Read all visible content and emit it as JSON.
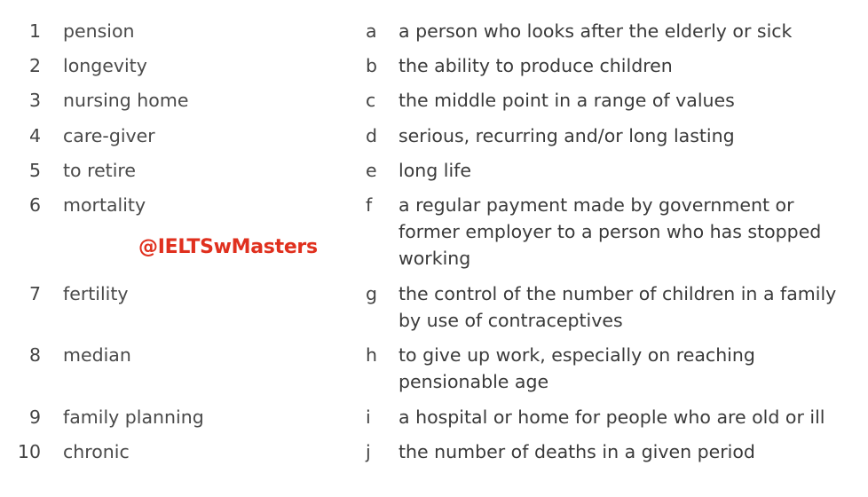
{
  "watermark": "@IELTSwMasters",
  "terms": [
    {
      "num": "1",
      "term": "pension"
    },
    {
      "num": "2",
      "term": "longevity"
    },
    {
      "num": "3",
      "term": "nursing home"
    },
    {
      "num": "4",
      "term": "care-giver"
    },
    {
      "num": "5",
      "term": "to retire"
    },
    {
      "num": "6",
      "term": "mortality"
    },
    {
      "num": "7",
      "term": "fertility"
    },
    {
      "num": "8",
      "term": "median"
    },
    {
      "num": "9",
      "term": "family planning"
    },
    {
      "num": "10",
      "term": "chronic"
    }
  ],
  "definitions": [
    {
      "letter": "a",
      "text": "a person who looks after the elderly or sick"
    },
    {
      "letter": "b",
      "text": "the ability to produce children"
    },
    {
      "letter": "c",
      "text": "the middle point in a range of values"
    },
    {
      "letter": "d",
      "text": "serious, recurring and/or long lasting"
    },
    {
      "letter": "e",
      "text": "long life"
    },
    {
      "letter": "f",
      "text": "a regular payment made by government or former employer to a person who has stopped working"
    },
    {
      "letter": "g",
      "text": "the control of the number of children in a family by use of contraceptives"
    },
    {
      "letter": "h",
      "text": "to give up work, especially on reaching pensionable age"
    },
    {
      "letter": "i",
      "text": "a hospital or home for people who are old or ill"
    },
    {
      "letter": "j",
      "text": "the number of deaths in a given period"
    }
  ]
}
